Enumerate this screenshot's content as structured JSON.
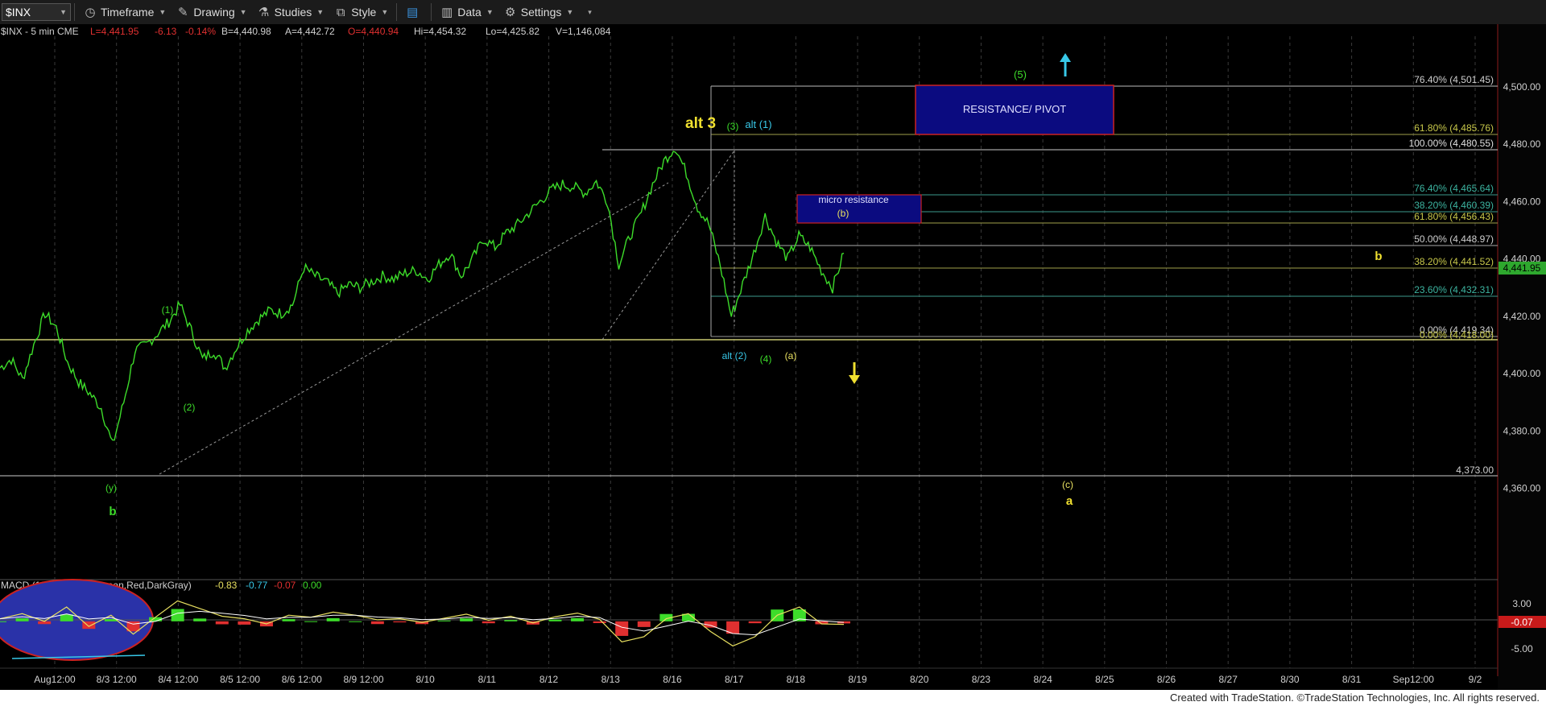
{
  "toolbar": {
    "symbol": "$INX",
    "timeframe": "Timeframe",
    "drawing": "Drawing",
    "studies": "Studies",
    "style": "Style",
    "data": "Data",
    "settings": "Settings"
  },
  "header": {
    "symbol_info": "$INX - 5 min  CME",
    "last": "L=4,441.95",
    "change": "-6.13",
    "change_pct": "-0.14%",
    "bid": "B=4,440.98",
    "ask": "A=4,442.72",
    "open": "O=4,440.94",
    "high": "Hi=4,454.32",
    "low": "Lo=4,425.82",
    "volume": "V=1,146,084"
  },
  "footer": "Created with TradeStation. ©TradeStation Technologies, Inc. All rights reserved.",
  "colors": {
    "price": "#3ddc2a",
    "fib_yellow": "#c8c84a",
    "fib_teal": "#3cb4a0",
    "resistance_fill": "#0b0b80",
    "resistance_border": "#cc2222",
    "last_price_bg": "#2ea82e",
    "macd_neg_bg": "#c81a1a"
  },
  "chart_data": {
    "type": "line",
    "title": "",
    "ylim": [
      4340,
      4520
    ],
    "y_ticks": [
      "4,500.00",
      "4,480.00",
      "4,460.00",
      "4,440.00",
      "4,420.00",
      "4,400.00",
      "4,380.00",
      "4,360.00"
    ],
    "x_ticks": [
      "Aug12:00",
      "8/3 12:00",
      "8/4 12:00",
      "8/5 12:00",
      "8/6 12:00",
      "8/9 12:00",
      "8/10",
      "8/11",
      "8/12",
      "8/13",
      "8/16",
      "8/17",
      "8/18",
      "8/19",
      "8/20",
      "8/23",
      "8/24",
      "8/25",
      "8/26",
      "8/27",
      "8/30",
      "8/31",
      "Sep12:00",
      "9/2"
    ],
    "last_price": "4,441.95",
    "series": [
      {
        "values": [
          4402,
          4405,
          4398,
          4410,
          4421,
          4416,
          4404,
          4397,
          4393,
          4388,
          4375,
          4390,
          4408,
          4410,
          4414,
          4418,
          4424,
          4415,
          4405,
          4408,
          4402,
          4409,
          4415,
          4419,
          4422,
          4421,
          4424,
          4437,
          4434,
          4432,
          4428,
          4431,
          4430,
          4432,
          4434,
          4433,
          4435,
          4436,
          4433,
          4438,
          4442,
          4434,
          4440,
          4447,
          4444,
          4449,
          4452,
          4456,
          4460,
          4464,
          4466,
          4465,
          4463,
          4467,
          4460,
          4438,
          4448,
          4456,
          4466,
          4474,
          4479,
          4470,
          4458,
          4452,
          4438,
          4420,
          4431,
          4442,
          4455,
          4446,
          4440,
          4448,
          4444,
          4436,
          4430,
          4441.95
        ]
      }
    ],
    "fib_levels": [
      {
        "label": "76.40% (4,501.45)",
        "value": 4501.45
      },
      {
        "label": "61.80% (4,485.76)",
        "value": 4485.76
      },
      {
        "label": "100.00% (4,480.55)",
        "value": 4480.55
      },
      {
        "label": "76.40% (4,465.64)",
        "value": 4465.64
      },
      {
        "label": "38.20% (4,460.39)",
        "value": 4460.39
      },
      {
        "label": "61.80% (4,456.43)",
        "value": 4456.43
      },
      {
        "label": "50.00% (4,448.97)",
        "value": 4448.97
      },
      {
        "label": "38.20% (4,441.52)",
        "value": 4441.52
      },
      {
        "label": "23.60% (4,432.31)",
        "value": 4432.31
      },
      {
        "label": "0.00% (4,419.34)",
        "value": 4419.34
      },
      {
        "label": "0.00% (4,418.00)",
        "value": 4418.0
      },
      {
        "label": "4,373.00",
        "value": 4373.0
      }
    ],
    "annotations": [
      {
        "text": "alt 3"
      },
      {
        "text": "(3)"
      },
      {
        "text": "alt (1)"
      },
      {
        "text": "(5)"
      },
      {
        "text": "RESISTANCE/ PIVOT"
      },
      {
        "text": "micro resistance"
      },
      {
        "text": "(b)"
      },
      {
        "text": "b"
      },
      {
        "text": "alt (2)"
      },
      {
        "text": "(4)"
      },
      {
        "text": "(a)"
      },
      {
        "text": "(1)"
      },
      {
        "text": "(2)"
      },
      {
        "text": "(y)"
      },
      {
        "text": "b"
      },
      {
        "text": "(c)"
      },
      {
        "text": "a"
      }
    ],
    "macd": {
      "label": "MACD (12,26,9, 1 , 1 ,Green,Red,DarkGray)",
      "values": [
        "-0.83",
        "-0.77",
        "-0.07",
        "0.00"
      ],
      "y_ticks": [
        "3.00",
        "-5.00"
      ],
      "last": "-0.07",
      "series": [
        0.5,
        1.5,
        0,
        2.8,
        -1,
        1.2,
        -2.5,
        0.8,
        4,
        2.5,
        1,
        0.5,
        -0.5,
        1.2,
        0.8,
        1.8,
        1.2,
        0.3,
        0.5,
        -0.2,
        0.6,
        1.4,
        0.2,
        1,
        -0.3,
        0.9,
        1.6,
        0.4,
        -4,
        -3,
        0.5,
        1.5,
        -2,
        -4.8,
        -3,
        1.2,
        2.8,
        -0.5,
        -0.6
      ]
    }
  }
}
